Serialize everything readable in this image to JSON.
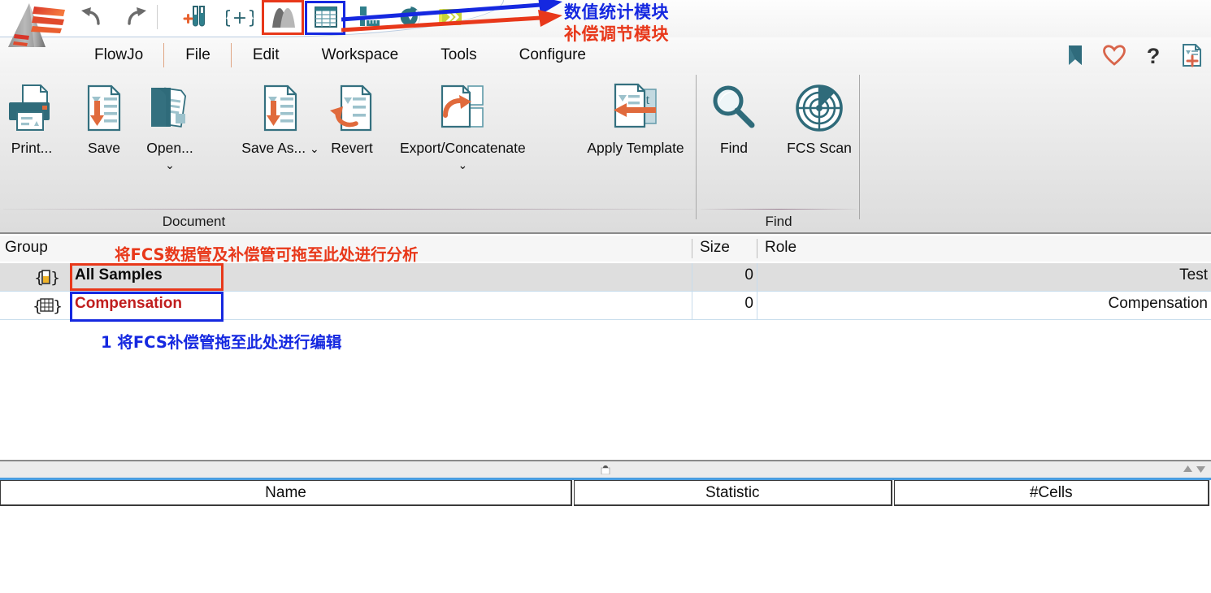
{
  "app": {
    "name": "FlowJo",
    "logo_icon": "flowjo-pyramid-logo"
  },
  "quick_access": {
    "undo_label": "undo-arrow-icon",
    "redo_label": "redo-arrow-icon",
    "tools": [
      {
        "id": "add-sample",
        "icon": "test-tubes-plus-icon"
      },
      {
        "id": "add-group",
        "icon": "curly-brace-plus-icon"
      },
      {
        "id": "compensation",
        "icon": "compensation-peaks-icon",
        "highlight": "red"
      },
      {
        "id": "table-editor",
        "icon": "table-grid-icon",
        "highlight": "blue"
      },
      {
        "id": "layout-editor",
        "icon": "ruler-bar-icon"
      },
      {
        "id": "plugin-circle",
        "icon": "circle-gauge-icon"
      },
      {
        "id": "batch-chevrons",
        "icon": "yellow-chevrons-icon"
      }
    ]
  },
  "annotations": {
    "toolbar_blue": "数值统计模块",
    "toolbar_red": "补偿调节模块",
    "workspace_red": "将FCS数据管及补偿管可拖至此处进行分析",
    "workspace_blue": "1 将FCS补偿管拖至此处进行编辑",
    "colors": {
      "blue": "#1528e0",
      "red": "#e8381a"
    }
  },
  "menu": {
    "items": [
      {
        "label": "FlowJo"
      },
      {
        "label": "File"
      },
      {
        "label": "Edit"
      },
      {
        "label": "Workspace"
      },
      {
        "label": "Tools"
      },
      {
        "label": "Configure"
      }
    ],
    "right_icons": [
      {
        "id": "bookmark",
        "icon": "bookmark-icon",
        "color": "#3d7b8c"
      },
      {
        "id": "favorite",
        "icon": "heart-icon",
        "color": "#d8654b"
      },
      {
        "id": "help",
        "icon": "question-mark-icon",
        "color": "#333333"
      },
      {
        "id": "new-doc",
        "icon": "new-document-plus-icon",
        "color": "#3d7b8c"
      }
    ]
  },
  "ribbon": {
    "groups": [
      {
        "name": "Document",
        "label": "Document",
        "buttons": [
          {
            "id": "print",
            "label": "Print...",
            "icon": "printer-icon",
            "has_chevron": false
          },
          {
            "id": "save",
            "label": "Save",
            "icon": "save-document-icon",
            "has_chevron": false
          },
          {
            "id": "open",
            "label": "Open...",
            "icon": "open-folder-icon",
            "has_chevron": true
          },
          {
            "id": "save-as",
            "label": "Save As...",
            "icon": "save-as-document-icon",
            "has_chevron": true
          },
          {
            "id": "revert",
            "label": "Revert",
            "icon": "revert-arrow-icon",
            "has_chevron": false
          },
          {
            "id": "export-concatenate",
            "label": "Export/Concatenate",
            "icon": "export-concatenate-icon",
            "has_chevron": true
          },
          {
            "id": "apply-template",
            "label": "Apply Template",
            "icon": "apply-template-icon",
            "has_chevron": false
          }
        ]
      },
      {
        "name": "Find",
        "label": "Find",
        "buttons": [
          {
            "id": "find",
            "label": "Find",
            "icon": "magnifier-icon",
            "has_chevron": false
          },
          {
            "id": "fcs-scan",
            "label": "FCS Scan",
            "icon": "radar-scan-icon",
            "has_chevron": false
          }
        ]
      }
    ]
  },
  "workspace": {
    "columns": [
      {
        "key": "group",
        "label": "Group"
      },
      {
        "key": "size",
        "label": "Size"
      },
      {
        "key": "role",
        "label": "Role"
      }
    ],
    "rows": [
      {
        "icon": "test-tube-brace-icon",
        "name": "All Samples",
        "size": "0",
        "role": "Test",
        "selected": true
      },
      {
        "icon": "grid-brace-icon",
        "name": "Compensation",
        "size": "0",
        "role": "Compensation",
        "selected": false
      }
    ]
  },
  "bottom_panel": {
    "columns": [
      {
        "key": "name",
        "label": "Name"
      },
      {
        "key": "statistic",
        "label": "Statistic"
      },
      {
        "key": "cells",
        "label": "#Cells"
      }
    ],
    "rows": []
  }
}
